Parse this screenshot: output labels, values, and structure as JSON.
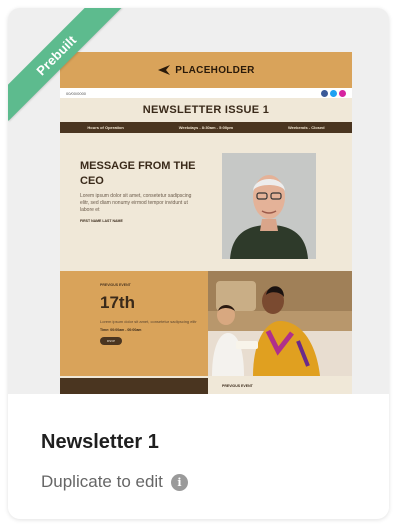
{
  "card": {
    "badge": "Prebuilt",
    "title": "Newsletter 1",
    "subtitle": "Duplicate to edit",
    "info_icon": "info-icon"
  },
  "preview": {
    "logo_text": "PLACEHOLDER",
    "date": "00/00/0000",
    "issue_title": "NEWSLETTER ISSUE 1",
    "hours": [
      "Hours of Operation",
      "Weekdays - 8:30am - 5:00pm",
      "Weekends - Closed"
    ],
    "ceo_heading": "MESSAGE FROM THE CEO",
    "ceo_body": "Lorem ipsum dolor sit amet, consetetur sadipscing elitr, sed diam nonumy eirmod tempor invidunt ut labore et",
    "ceo_signature": "FIRST NAME LAST NAME",
    "event_kicker": "PREVIOUS EVENT",
    "event_date": "17th",
    "event_body": "Lorem ipsum dolor sit amet, consetetur sadipscing elitr",
    "event_time": "Time: 00:00am - 00:00am",
    "event_button": "RSVP",
    "bottom_kicker": "PREVIOUS EVENT"
  },
  "colors": {
    "ribbon": "#5dbb8e",
    "header_tan": "#d9a35a",
    "cream": "#f0e8d8",
    "dark_brown": "#4a3520"
  }
}
